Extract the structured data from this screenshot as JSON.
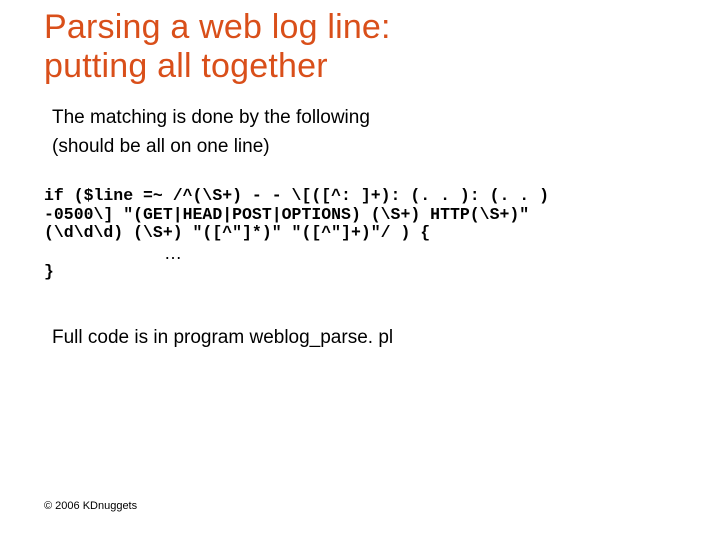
{
  "title_line1": "Parsing a web log line:",
  "title_line2": "putting all together",
  "lead1": "The matching is done by the following",
  "lead2": "(should be all on one line)",
  "code_line1": "if ($line =~ /^(\\S+) - - \\[([^: ]+): (. . ): (. . )",
  "code_line2": "-0500\\] \"(GET|HEAD|POST|OPTIONS) (\\S+) HTTP(\\S+)\"",
  "code_line3": "(\\d\\d\\d) (\\S+) \"([^\"]*)\" \"([^\"]+)\"/ ) {",
  "ellipsis": "…",
  "code_close": "}",
  "full_code": "Full code is in program weblog_parse. pl",
  "footer": "© 2006 KDnuggets"
}
